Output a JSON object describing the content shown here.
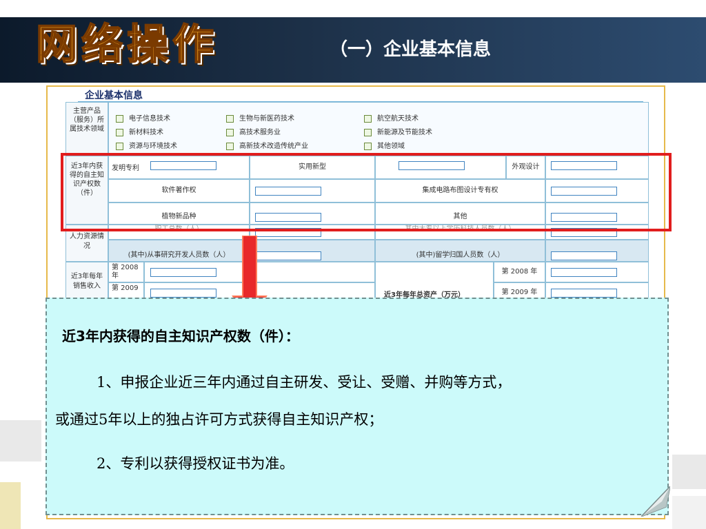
{
  "header": {
    "logo_text": "网络操作",
    "subtitle": "（一）企业基本信息"
  },
  "form": {
    "title": "企业基本信息",
    "field_main_products": {
      "label": "主营产品（服务）所属技术领域",
      "options": [
        [
          "电子信息技术",
          "生物与新医药技术",
          "航空航天技术"
        ],
        [
          "新材料技术",
          "高技术服务业",
          "新能源及节能技术"
        ],
        [
          "资源与环境技术",
          "高新技术改造传统产业",
          "其他领域"
        ]
      ]
    },
    "field_ip": {
      "label": "近3年内获得的自主知识产权数（件）",
      "items": [
        "发明专利",
        "实用新型",
        "外观设计",
        "软件著作权",
        "集成电路布图设计专有权",
        "植物新品种",
        "其他"
      ]
    },
    "field_hr": {
      "label": "人力资源情况",
      "items": [
        "职工总数（人）",
        "其中大专以上学历科技人员数（人）",
        "(其中)从事研究开发人员数（人）",
        "(其中)留学归国人员数（人）"
      ]
    },
    "field_sales": {
      "label": "近3年每年销售收入",
      "year_2008": "第 2008 年",
      "year_2009": "第 2009",
      "assets_label": "近3年每年总资产（万元）",
      "right_2008": "第 2008 年",
      "right_2009": "第 2009 年"
    }
  },
  "callout": {
    "heading": "近3年内获得的自主知识产权数（件）：",
    "para1_line1": "1、申报企业近三年内通过自主研发、受让、受赠、并购等方式，",
    "para1_line2": "或通过5年以上的独占许可方式获得自主知识产权；",
    "para2": "2、专利以获得授权证书为准。"
  },
  "colors": {
    "banner": "#1d3149",
    "logo": "#ffb12a",
    "highlight": "#e11d1d",
    "callout_bg": "#ccfafa",
    "form_border": "#e6b94a"
  }
}
